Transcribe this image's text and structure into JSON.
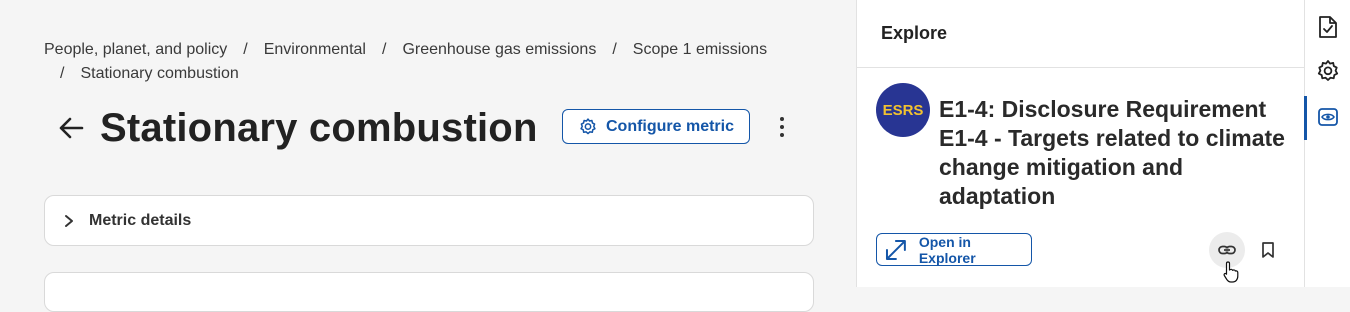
{
  "breadcrumb": {
    "items": [
      "People, planet, and policy",
      "Environmental",
      "Greenhouse gas emissions",
      "Scope 1 emissions",
      "Stationary combustion"
    ],
    "separator": "/"
  },
  "header": {
    "title": "Stationary combustion",
    "configure_label": "Configure metric"
  },
  "details": {
    "label": "Metric details"
  },
  "explore": {
    "title": "Explore",
    "badge": "ESRS",
    "requirement_title": "E1-4: Disclosure Requirement E1-4 - Targets related to climate change mitigation and adaptation",
    "open_label": "Open in Explorer"
  },
  "colors": {
    "accent": "#1456a8",
    "badge_bg": "#283593",
    "badge_text": "#f2c230"
  },
  "icons": {
    "rail": [
      "document-check-icon",
      "gear-icon",
      "eye-icon"
    ],
    "actions": [
      "link-icon",
      "bookmark-icon"
    ]
  }
}
